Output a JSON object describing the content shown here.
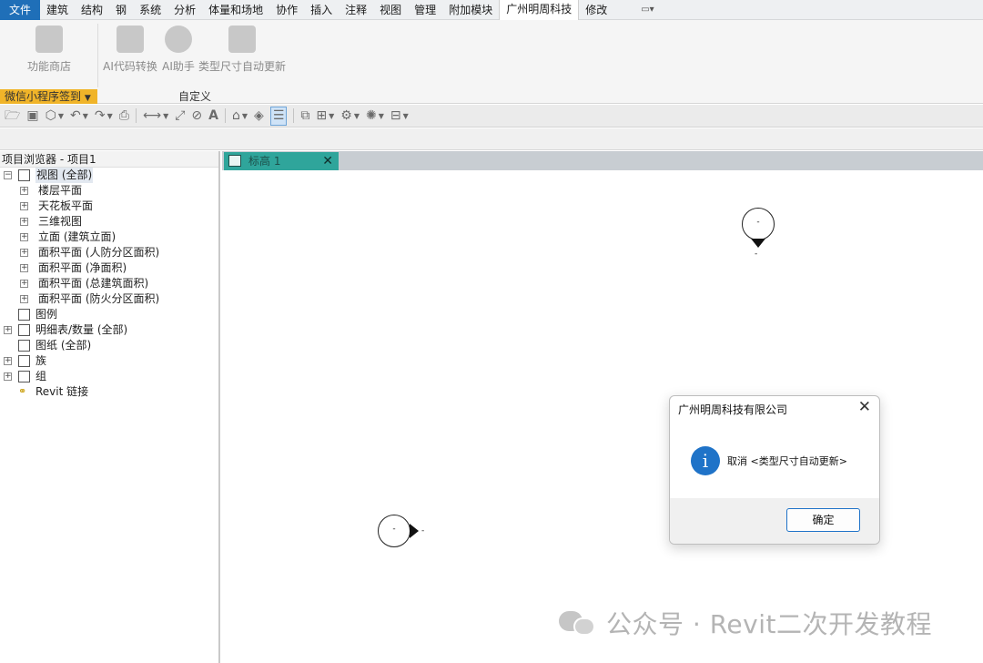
{
  "menu": {
    "items": [
      "文件",
      "建筑",
      "结构",
      "钢",
      "系统",
      "分析",
      "体量和场地",
      "协作",
      "插入",
      "注释",
      "视图",
      "管理",
      "附加模块",
      "广州明周科技",
      "修改"
    ],
    "active": "广州明周科技",
    "extra_icon": "monitor-dropdown-icon"
  },
  "ribbon": {
    "buttons": [
      {
        "label": "功能商店",
        "icon": "gift-box-icon"
      },
      {
        "label": "AI代码转换",
        "icon": "code-convert-icon"
      },
      {
        "label": "AI助手",
        "icon": "robot-icon"
      },
      {
        "label": "类型尺寸自动更新",
        "icon": "edit-document-icon"
      }
    ],
    "panels": {
      "wechat": "微信小程序签到",
      "custom": "自定义"
    }
  },
  "qat": {
    "icons": [
      "open-icon",
      "save-icon",
      "sync-icon",
      "undo-icon",
      "redo-icon",
      "print-icon",
      "measure-icon",
      "dimension-icon",
      "tag-icon",
      "text-icon",
      "3d-view-icon",
      "section-icon",
      "thin-lines-icon",
      "close-hidden-icon",
      "switch-windows-icon",
      "settings-icon",
      "render-icon",
      "tab-views-icon"
    ]
  },
  "browser": {
    "title": "项目浏览器 - 项目1",
    "tree": [
      {
        "label": "视图 (全部)",
        "level": 0,
        "toggle": "minus",
        "icon": "views-icon",
        "selected": true
      },
      {
        "label": "楼层平面",
        "level": 1,
        "toggle": "plus"
      },
      {
        "label": "天花板平面",
        "level": 1,
        "toggle": "plus"
      },
      {
        "label": "三维视图",
        "level": 1,
        "toggle": "plus"
      },
      {
        "label": "立面 (建筑立面)",
        "level": 1,
        "toggle": "plus"
      },
      {
        "label": "面积平面 (人防分区面积)",
        "level": 1,
        "toggle": "plus"
      },
      {
        "label": "面积平面 (净面积)",
        "level": 1,
        "toggle": "plus"
      },
      {
        "label": "面积平面 (总建筑面积)",
        "level": 1,
        "toggle": "plus"
      },
      {
        "label": "面积平面 (防火分区面积)",
        "level": 1,
        "toggle": "plus"
      },
      {
        "label": "图例",
        "level": 0,
        "toggle": "",
        "icon": "legend-icon"
      },
      {
        "label": "明细表/数量 (全部)",
        "level": 0,
        "toggle": "plus",
        "icon": "schedule-icon"
      },
      {
        "label": "图纸 (全部)",
        "level": 0,
        "toggle": "",
        "icon": "sheet-icon"
      },
      {
        "label": "族",
        "level": 0,
        "toggle": "plus",
        "icon": "family-icon"
      },
      {
        "label": "组",
        "level": 0,
        "toggle": "plus",
        "icon": "group-icon"
      },
      {
        "label": "Revit 链接",
        "level": 0,
        "toggle": "",
        "icon": "link-icon"
      }
    ]
  },
  "doc": {
    "tab_label": "标高 1",
    "close": "✕",
    "level_marks": [
      {
        "label": "-",
        "sub": "-"
      },
      {
        "label": "-",
        "sub": "-"
      }
    ]
  },
  "dialog": {
    "title": "广州明周科技有限公司",
    "close": "✕",
    "info_glyph": "i",
    "message": "取消 <类型尺寸自动更新>",
    "ok": "确定"
  },
  "watermark": {
    "text": "公众号 · Revit二次开发教程"
  }
}
